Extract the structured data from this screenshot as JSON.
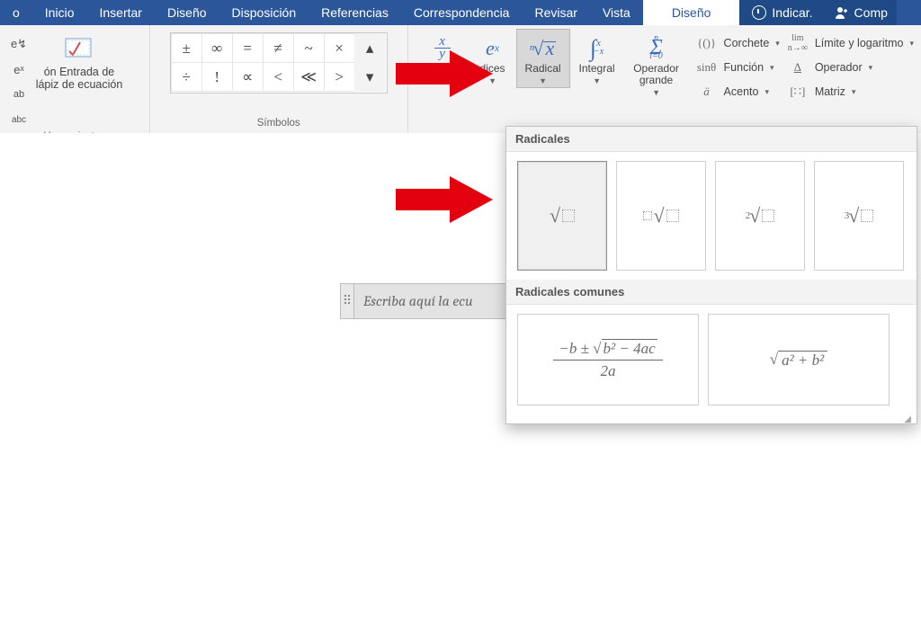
{
  "tabs": {
    "file_suffix": "o",
    "items": [
      "Inicio",
      "Insertar",
      "Diseño",
      "Disposición",
      "Referencias",
      "Correspondencia",
      "Revisar",
      "Vista"
    ],
    "context": "Diseño",
    "tell_me": "Indicar.",
    "share": "Comp"
  },
  "ribbon": {
    "tools_group": "Herramientas",
    "ink_equation": "ón Entrada de lápiz de ecuación",
    "symbols_group": "Símbolos",
    "mini": {
      "e_pi": "e↯",
      "e_x": "eˣ",
      "ab": "ab",
      "abc": "abc"
    },
    "symbols": [
      "±",
      "∞",
      "=",
      "≠",
      "~",
      "×",
      "÷",
      "!",
      "∝",
      "<",
      "≪",
      ">"
    ],
    "structures": {
      "fraction": "Fracción",
      "indices": "Índices",
      "radical": "Radical",
      "integral": "Integral",
      "big_op": "Operador grande"
    },
    "side": {
      "bracket": "Corchete",
      "limit": "Límite y logaritmo",
      "function": "Función",
      "operator": "Operador",
      "accent": "Acento",
      "matrix": "Matriz"
    }
  },
  "equation_placeholder": "Escriba aquí la ecu",
  "gallery": {
    "section1": "Radicales",
    "section2": "Radicales comunes",
    "common2": "√(a² + b²)"
  }
}
